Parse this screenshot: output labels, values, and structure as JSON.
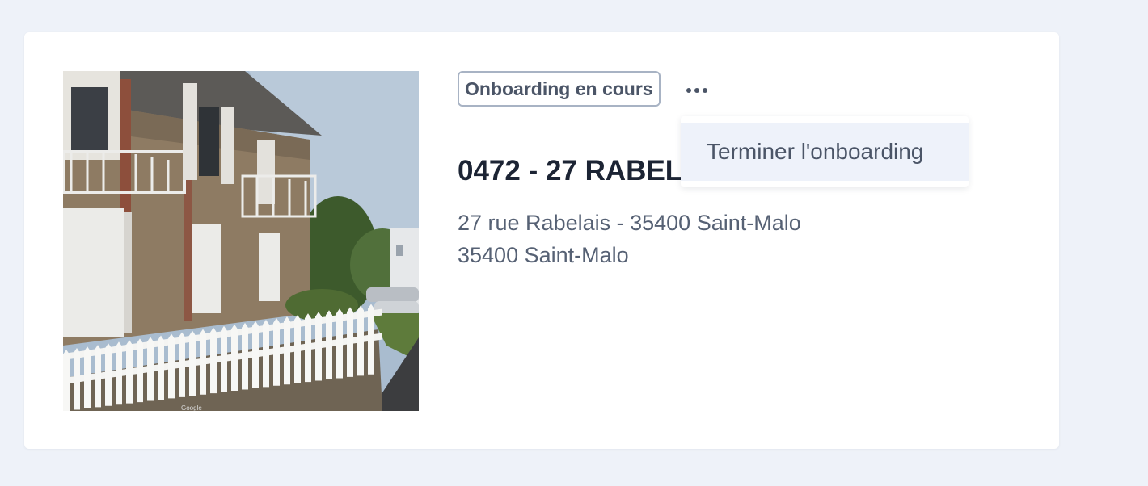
{
  "property": {
    "status_badge": "Onboarding en cours",
    "title": "0472 - 27 RABELAIS",
    "address_line1": "27 rue Rabelais - 35400 Saint-Malo",
    "address_line2": "35400 Saint-Malo",
    "photo_attribution": "Google"
  },
  "actions_menu": {
    "toggle_icon": "more-horizontal-icon",
    "items": [
      {
        "label": "Terminer l'onboarding"
      }
    ]
  },
  "colors": {
    "page_background": "#eef2f9",
    "card_background": "#ffffff",
    "title_text": "#1c2434",
    "secondary_text": "#566174",
    "badge_border": "#a8b3c4",
    "menu_item_highlight": "#eef2fa"
  }
}
